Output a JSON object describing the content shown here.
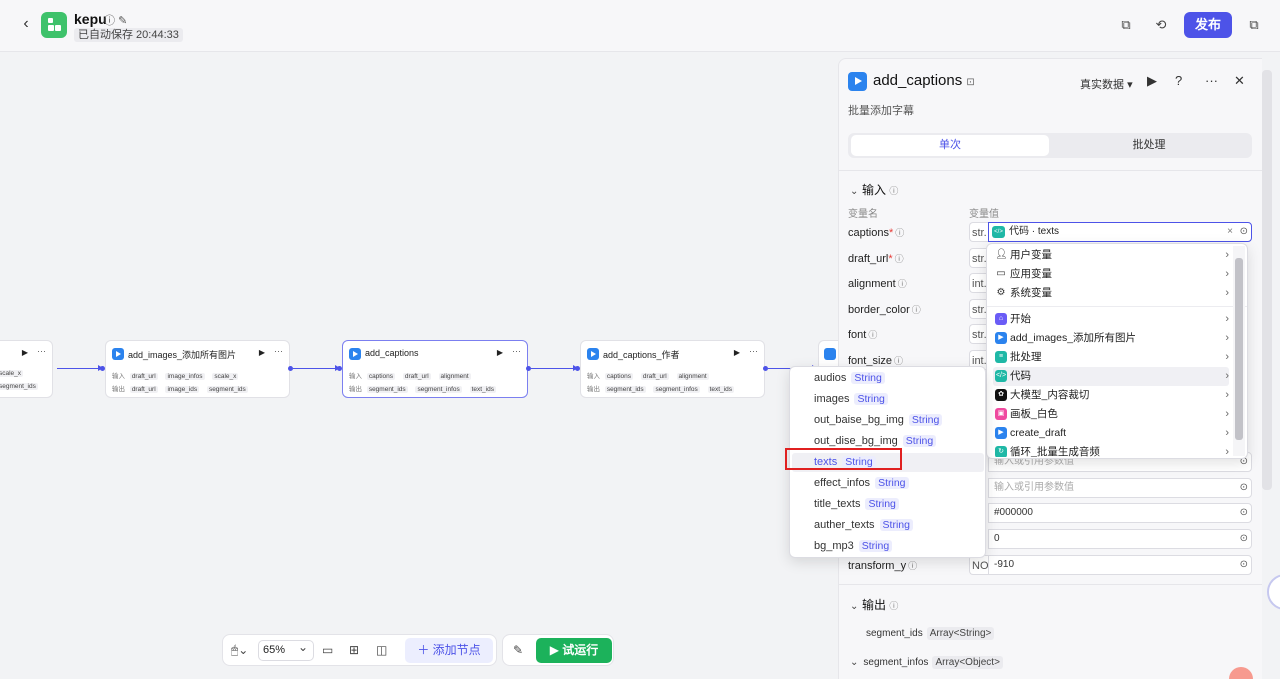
{
  "header": {
    "app_title": "kepu",
    "autosave": "已自动保存 20:44:33",
    "publish_label": "发布"
  },
  "canvas": {
    "zoom": "65%",
    "add_node_label": "添加节点",
    "run_label": "试运行",
    "nodes": [
      {
        "title": "add_images_添加所有图片",
        "in_label": "输入",
        "out_label": "输出",
        "in_tags": [
          "draft_url",
          "image_infos",
          "scale_x"
        ],
        "out_tags": [
          "draft_url",
          "image_ids",
          "segment_ids"
        ]
      },
      {
        "title": "add_captions",
        "in_label": "输入",
        "out_label": "输出",
        "in_tags": [
          "captions",
          "draft_url",
          "alignment"
        ],
        "out_tags": [
          "segment_ids",
          "segment_infos",
          "text_ids"
        ]
      },
      {
        "title": "add_captions_作者",
        "in_label": "输入",
        "out_label": "输出",
        "in_tags": [
          "captions",
          "draft_url",
          "alignment"
        ],
        "out_tags": [
          "segment_ids",
          "segment_infos",
          "text_ids"
        ]
      }
    ],
    "partial_node_left_tags": [
      "scale_x",
      "segment_ids"
    ]
  },
  "panel": {
    "title": "add_captions",
    "description": "批量添加字幕",
    "data_mode": "真实数据",
    "tabs": [
      "单次",
      "批处理"
    ],
    "input_section": "输入",
    "col_name": "变量名",
    "col_value": "变量值",
    "params": [
      {
        "name": "captions",
        "required": true,
        "type": "str.",
        "value": "代码 · texts"
      },
      {
        "name": "draft_url",
        "required": true,
        "type": "str.",
        "value": ""
      },
      {
        "name": "alignment",
        "required": false,
        "type": "int.",
        "value": ""
      },
      {
        "name": "border_color",
        "required": false,
        "type": "str.",
        "value": ""
      },
      {
        "name": "font",
        "required": false,
        "type": "str.",
        "value": ""
      },
      {
        "name": "font_size",
        "required": false,
        "type": "int.",
        "value": ""
      }
    ],
    "lower_inputs": [
      {
        "value": "",
        "placeholder": "输入或引用参数值"
      },
      {
        "value": "",
        "placeholder": "输入或引用参数值"
      },
      {
        "value": "#000000",
        "placeholder": ""
      },
      {
        "value": "0",
        "placeholder": ""
      },
      {
        "value": "-910",
        "placeholder": ""
      }
    ],
    "transform_y": {
      "name": "transform_y",
      "type": "NO"
    },
    "output_section": "输出",
    "outputs": [
      {
        "name": "segment_ids",
        "type": "Array<String>"
      },
      {
        "name": "segment_infos",
        "type": "Array<Object>"
      }
    ]
  },
  "var_menu": {
    "items": [
      {
        "label": "用户变量",
        "icon": "user-icon"
      },
      {
        "label": "应用变量",
        "icon": "folder-icon"
      },
      {
        "label": "系统变量",
        "icon": "gear-icon"
      },
      {
        "label": "开始",
        "icon": "start-icon",
        "color": "#6a5cf6"
      },
      {
        "label": "add_images_添加所有图片",
        "icon": "plugin-icon",
        "color": "#2b83ee"
      },
      {
        "label": "批处理",
        "icon": "batch-icon",
        "color": "#1fb8a6"
      },
      {
        "label": "代码",
        "icon": "code-icon",
        "color": "#1fb8a6"
      },
      {
        "label": "大模型_内容裁切",
        "icon": "llm-icon",
        "color": "#111111"
      },
      {
        "label": "画板_白色",
        "icon": "canvas-icon",
        "color": "#f04aa0"
      },
      {
        "label": "create_draft",
        "icon": "plugin-icon",
        "color": "#2b83ee"
      },
      {
        "label": "循环_批量生成音频",
        "icon": "loop-icon",
        "color": "#1fb8a6"
      }
    ]
  },
  "sub_menu": {
    "items": [
      {
        "name": "audios",
        "type": "String"
      },
      {
        "name": "images",
        "type": "String"
      },
      {
        "name": "out_baise_bg_img",
        "type": "String"
      },
      {
        "name": "out_dise_bg_img",
        "type": "String"
      },
      {
        "name": "texts",
        "type": "String"
      },
      {
        "name": "effect_infos",
        "type": "String"
      },
      {
        "name": "title_texts",
        "type": "String"
      },
      {
        "name": "auther_texts",
        "type": "String"
      },
      {
        "name": "bg_mp3",
        "type": "String"
      }
    ]
  },
  "colors": {
    "accent": "#4d53e8",
    "run_green": "#1cb25b",
    "highlight_red": "#e02020"
  }
}
